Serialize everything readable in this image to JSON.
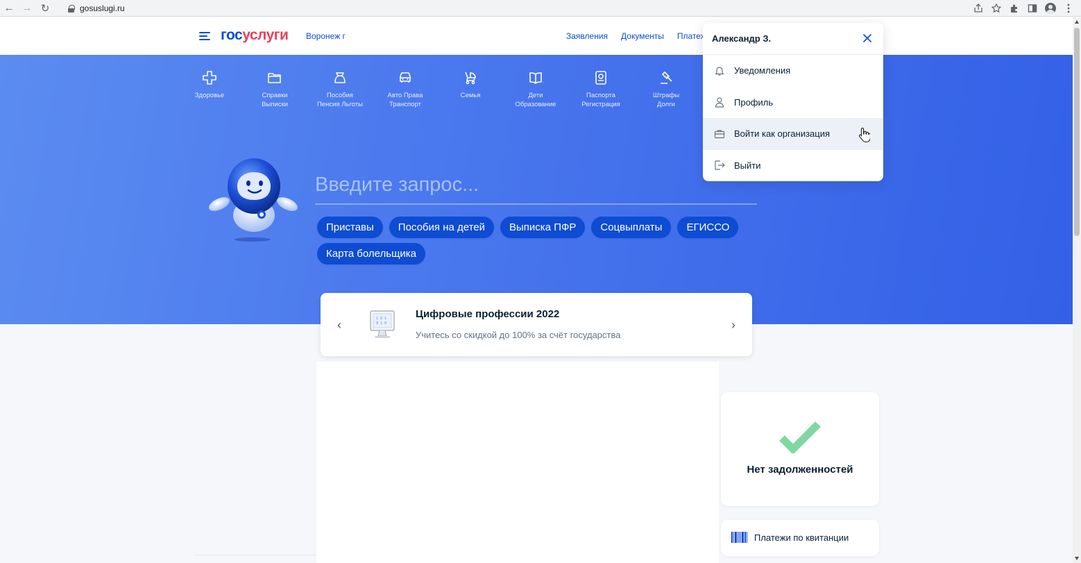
{
  "browser": {
    "url": "gosuslugi.ru"
  },
  "header": {
    "logo_part1": "гос",
    "logo_part2": "услуги",
    "region": "Воронеж г",
    "nav": [
      "Заявления",
      "Документы",
      "Платежи"
    ]
  },
  "categories": [
    {
      "icon": "plus-icon",
      "line1": "Здоровье",
      "line2": ""
    },
    {
      "icon": "folder-icon",
      "line1": "Справки",
      "line2": "Выписки"
    },
    {
      "icon": "wallet-icon",
      "line1": "Пособия",
      "line2": "Пенсия Льготы"
    },
    {
      "icon": "car-icon",
      "line1": "Авто Права",
      "line2": "Транспорт"
    },
    {
      "icon": "stroller-icon",
      "line1": "Семья",
      "line2": ""
    },
    {
      "icon": "book-icon",
      "line1": "Дети",
      "line2": "Образование"
    },
    {
      "icon": "passport-icon",
      "line1": "Паспорта",
      "line2": "Регистрация"
    },
    {
      "icon": "gavel-icon",
      "line1": "Штрафы",
      "line2": "Долги"
    }
  ],
  "search": {
    "placeholder": "Введите запрос..."
  },
  "chips": [
    "Приставы",
    "Пособия на детей",
    "Выписка ПФР",
    "Соцвыплаты",
    "ЕГИССО",
    "Карта болельщика"
  ],
  "promo": {
    "title": "Цифровые профессии 2022",
    "subtitle": "Учитесь со скидкой до 100% за счёт государства"
  },
  "debts": {
    "label": "Нет задолженностей"
  },
  "payments": {
    "label": "Платежи по квитанции"
  },
  "user_menu": {
    "user_name": "Александр З.",
    "items": [
      {
        "icon": "bell-icon",
        "label": "Уведомления"
      },
      {
        "icon": "person-icon",
        "label": "Профиль"
      },
      {
        "icon": "briefcase-icon",
        "label": "Войти как организация"
      },
      {
        "icon": "logout-icon",
        "label": "Выйти"
      }
    ]
  },
  "colors": {
    "brand_blue": "#0d4cd3",
    "brand_red": "#ee3f58",
    "hero_blue": "#4a78ee",
    "check_green": "#7fd8a3"
  }
}
